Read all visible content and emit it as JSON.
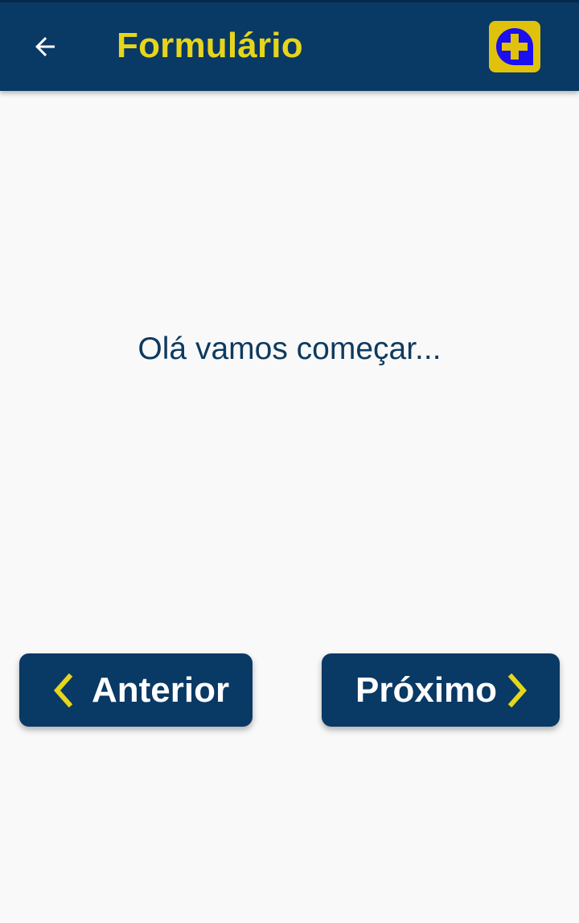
{
  "app_bar": {
    "title": "Formulário",
    "back_icon": "arrow-left-icon",
    "add_icon": "plus-circle-icon",
    "background_color": "#093965",
    "title_color": "#e6d51b"
  },
  "main": {
    "greeting": "Olá vamos começar..."
  },
  "navigation": {
    "previous_label": "Anterior",
    "next_label": "Próximo",
    "previous_icon": "chevron-left-icon",
    "next_icon": "chevron-right-icon",
    "chevron_color": "#e6d51b"
  }
}
